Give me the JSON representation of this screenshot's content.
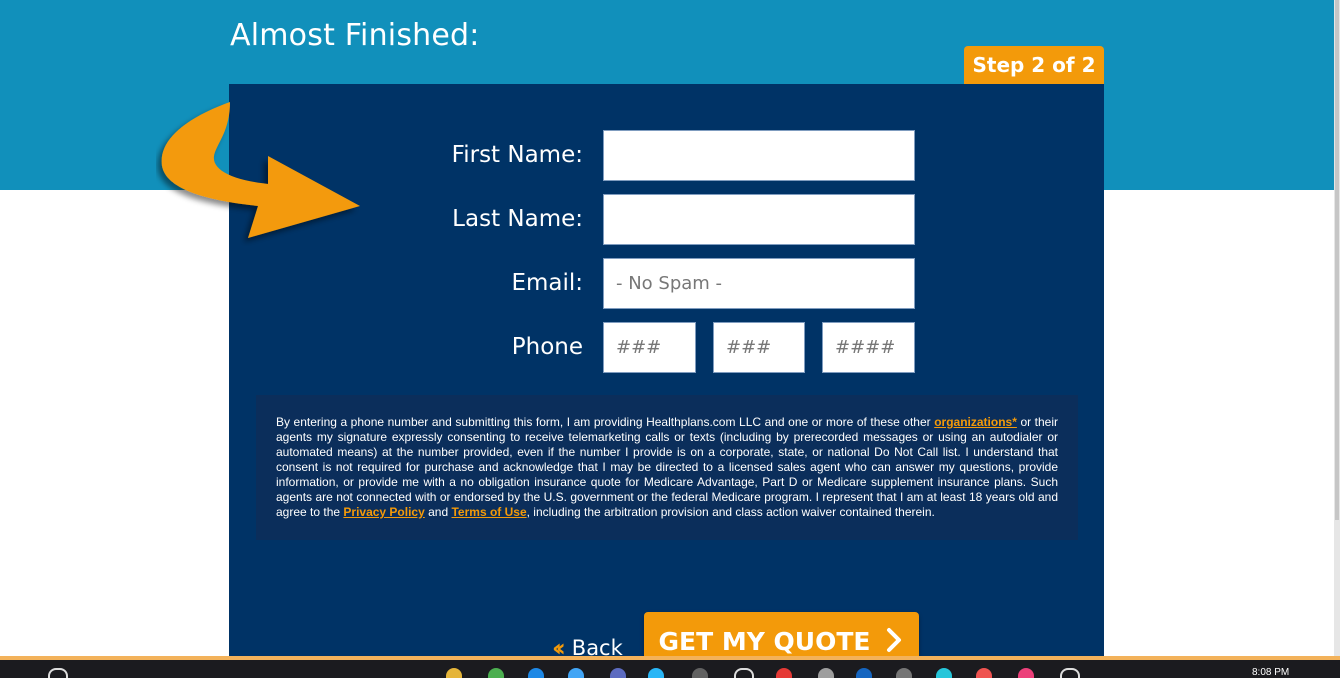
{
  "header": {
    "title": "Almost Finished:",
    "step_label": "Step 2 of 2"
  },
  "form": {
    "first_name_label": "First Name:",
    "last_name_label": "Last Name:",
    "email_label": "Email:",
    "email_placeholder": "- No Spam -",
    "phone_label": "Phone",
    "phone_area_placeholder": "###",
    "phone_prefix_placeholder": "###",
    "phone_line_placeholder": "####"
  },
  "consent": {
    "text_1": "By entering a phone number and submitting this form, I am providing Healthplans.com LLC and one or more of these other ",
    "organizations_link": "organizations*",
    "text_2": " or their agents my signature expressly consenting to receive telemarketing calls or texts (including by prerecorded messages or using an autodialer or automated means) at the number provided, even if the number I provide is on a corporate, state, or national Do Not Call list. I understand that consent is not required for purchase and acknowledge that I may be directed to a licensed sales agent who can answer my questions, provide information, or provide me with a no obligation insurance quote for Medicare Advantage, Part D or Medicare supplement insurance plans. Such agents are not connected with or endorsed by the U.S. government or the federal Medicare program. I represent that I am at least 18 years old and agree to the ",
    "privacy_link": "Privacy Policy",
    "text_3": " and ",
    "terms_link": "Terms of Use",
    "text_4": ", including the arbitration provision and class action waiver contained therein."
  },
  "actions": {
    "back_label": "Back",
    "submit_label": "GET MY QUOTE"
  },
  "taskbar": {
    "clock": "8:08 PM"
  },
  "colors": {
    "top_band": "#1190bb",
    "panel": "#003366",
    "accent": "#f39a0a"
  },
  "icons": {
    "arrow": "curved-arrow-icon",
    "back": "double-chevron-left-icon",
    "submit": "chevron-right-icon"
  }
}
